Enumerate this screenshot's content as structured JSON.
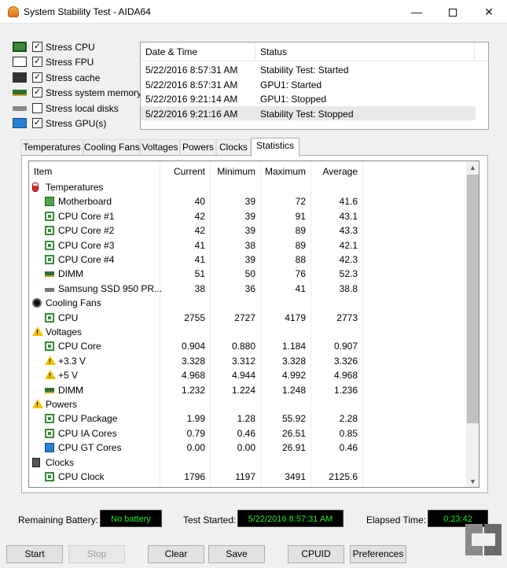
{
  "window": {
    "title": "System Stability Test - AIDA64",
    "minimize": "—",
    "close": "✕"
  },
  "stress_options": [
    {
      "label": "Stress CPU",
      "checked": true,
      "icon": "cpu-chip-icon"
    },
    {
      "label": "Stress FPU",
      "checked": true,
      "icon": "fpu-icon"
    },
    {
      "label": "Stress cache",
      "checked": true,
      "icon": "cache-icon"
    },
    {
      "label": "Stress system memory",
      "checked": true,
      "icon": "memory-module-icon"
    },
    {
      "label": "Stress local disks",
      "checked": false,
      "icon": "disk-drive-icon"
    },
    {
      "label": "Stress GPU(s)",
      "checked": true,
      "icon": "gpu-monitor-icon"
    }
  ],
  "log": {
    "headers": {
      "date": "Date & Time",
      "status": "Status"
    },
    "rows": [
      {
        "date": "5/22/2016 8:57:31 AM",
        "status": "Stability Test: Started"
      },
      {
        "date": "5/22/2016 8:57:31 AM",
        "status": "GPU1: Started"
      },
      {
        "date": "5/22/2016 9:21:14 AM",
        "status": "GPU1: Stopped"
      },
      {
        "date": "5/22/2016 9:21:16 AM",
        "status": "Stability Test: Stopped"
      }
    ]
  },
  "tabs": [
    "Temperatures",
    "Cooling Fans",
    "Voltages",
    "Powers",
    "Clocks",
    "Statistics"
  ],
  "active_tab": "Statistics",
  "stats": {
    "headers": {
      "item": "Item",
      "current": "Current",
      "minimum": "Minimum",
      "maximum": "Maximum",
      "average": "Average"
    },
    "rows": [
      {
        "kind": "group",
        "label": "Temperatures",
        "icon": "thermometer-icon"
      },
      {
        "kind": "item",
        "label": "Motherboard",
        "icon": "motherboard-icon",
        "current": "40",
        "minimum": "39",
        "maximum": "72",
        "average": "41.6"
      },
      {
        "kind": "item",
        "label": "CPU Core #1",
        "icon": "cpu-chip-icon",
        "current": "42",
        "minimum": "39",
        "maximum": "91",
        "average": "43.1"
      },
      {
        "kind": "item",
        "label": "CPU Core #2",
        "icon": "cpu-chip-icon",
        "current": "42",
        "minimum": "39",
        "maximum": "89",
        "average": "43.3"
      },
      {
        "kind": "item",
        "label": "CPU Core #3",
        "icon": "cpu-chip-icon",
        "current": "41",
        "minimum": "38",
        "maximum": "89",
        "average": "42.1"
      },
      {
        "kind": "item",
        "label": "CPU Core #4",
        "icon": "cpu-chip-icon",
        "current": "41",
        "minimum": "39",
        "maximum": "88",
        "average": "42.3"
      },
      {
        "kind": "item",
        "label": "DIMM",
        "icon": "memory-module-icon",
        "current": "51",
        "minimum": "50",
        "maximum": "76",
        "average": "52.3"
      },
      {
        "kind": "item",
        "label": "Samsung SSD 950 PR...",
        "icon": "ssd-icon",
        "current": "38",
        "minimum": "36",
        "maximum": "41",
        "average": "38.8"
      },
      {
        "kind": "group",
        "label": "Cooling Fans",
        "icon": "fan-icon"
      },
      {
        "kind": "item",
        "label": "CPU",
        "icon": "cpu-chip-icon",
        "current": "2755",
        "minimum": "2727",
        "maximum": "4179",
        "average": "2773"
      },
      {
        "kind": "group",
        "label": "Voltages",
        "icon": "warning-icon"
      },
      {
        "kind": "item",
        "label": "CPU Core",
        "icon": "cpu-chip-icon",
        "current": "0.904",
        "minimum": "0.880",
        "maximum": "1.184",
        "average": "0.907"
      },
      {
        "kind": "item",
        "label": "+3.3 V",
        "icon": "warning-icon",
        "current": "3.328",
        "minimum": "3.312",
        "maximum": "3.328",
        "average": "3.326"
      },
      {
        "kind": "item",
        "label": "+5 V",
        "icon": "warning-icon",
        "current": "4.968",
        "minimum": "4.944",
        "maximum": "4.992",
        "average": "4.968"
      },
      {
        "kind": "item",
        "label": "DIMM",
        "icon": "memory-module-icon",
        "current": "1.232",
        "minimum": "1.224",
        "maximum": "1.248",
        "average": "1.236"
      },
      {
        "kind": "group",
        "label": "Powers",
        "icon": "warning-icon"
      },
      {
        "kind": "item",
        "label": "CPU Package",
        "icon": "cpu-chip-icon",
        "current": "1.99",
        "minimum": "1.28",
        "maximum": "55.92",
        "average": "2.28"
      },
      {
        "kind": "item",
        "label": "CPU IA Cores",
        "icon": "cpu-chip-icon",
        "current": "0.79",
        "minimum": "0.46",
        "maximum": "26.51",
        "average": "0.85"
      },
      {
        "kind": "item",
        "label": "CPU GT Cores",
        "icon": "gpu-monitor-icon",
        "current": "0.00",
        "minimum": "0.00",
        "maximum": "26.91",
        "average": "0.46"
      },
      {
        "kind": "group",
        "label": "Clocks",
        "icon": "clock-icon"
      },
      {
        "kind": "item",
        "label": "CPU Clock",
        "icon": "cpu-chip-icon",
        "current": "1796",
        "minimum": "1197",
        "maximum": "3491",
        "average": "2125.6"
      }
    ]
  },
  "status_bar": {
    "battery_label": "Remaining Battery:",
    "battery_value": "No battery",
    "started_label": "Test Started:",
    "started_value": "5/22/2016 8:57:31 AM",
    "elapsed_label": "Elapsed Time:",
    "elapsed_value": "0:23:42"
  },
  "buttons": {
    "start": "Start",
    "stop": "Stop",
    "clear": "Clear",
    "save": "Save",
    "cpuid": "CPUID",
    "preferences": "Preferences"
  },
  "colors": {
    "lcd_text": "#22e82f",
    "lcd_bg": "#000000"
  }
}
